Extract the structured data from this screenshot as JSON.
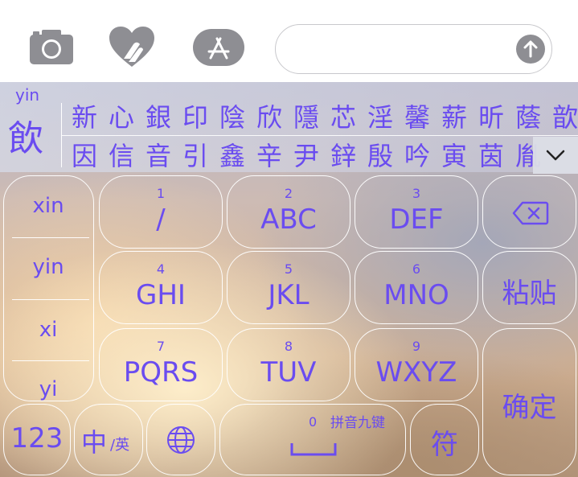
{
  "message_bar": {
    "icons": [
      "camera-icon",
      "digital-touch-heart-icon",
      "app-store-icon",
      "send-arrow-icon"
    ],
    "input_placeholder": ""
  },
  "candidates": {
    "pinyin": "yin",
    "current": "飲",
    "row1": [
      "新",
      "心",
      "銀",
      "印",
      "陰",
      "欣",
      "隱",
      "芯",
      "淫",
      "馨",
      "薪",
      "昕",
      "蔭",
      "歆"
    ],
    "row2": [
      "因",
      "信",
      "音",
      "引",
      "鑫",
      "辛",
      "尹",
      "鋅",
      "殷",
      "吟",
      "寅",
      "茵",
      "胤"
    ]
  },
  "pinyin_list": [
    "xin",
    "yin",
    "xi",
    "yi"
  ],
  "keys": {
    "k1": {
      "num": "1",
      "letters": "/"
    },
    "k2": {
      "num": "2",
      "letters": "ABC"
    },
    "k3": {
      "num": "3",
      "letters": "DEF"
    },
    "k4": {
      "num": "4",
      "letters": "GHI"
    },
    "k5": {
      "num": "5",
      "letters": "JKL"
    },
    "k6": {
      "num": "6",
      "letters": "MNO"
    },
    "k7": {
      "num": "7",
      "letters": "PQRS"
    },
    "k8": {
      "num": "8",
      "letters": "TUV"
    },
    "k9": {
      "num": "9",
      "letters": "WXYZ"
    },
    "paste": "粘贴",
    "confirm": "确定",
    "numbers": "123",
    "lang_main": "中",
    "lang_sub": "/英",
    "space_num": "0",
    "space_label": "拼音九键",
    "symbols": "符"
  },
  "colors": {
    "accent": "#6a4cf0",
    "icon_gray": "#8e8e93"
  }
}
